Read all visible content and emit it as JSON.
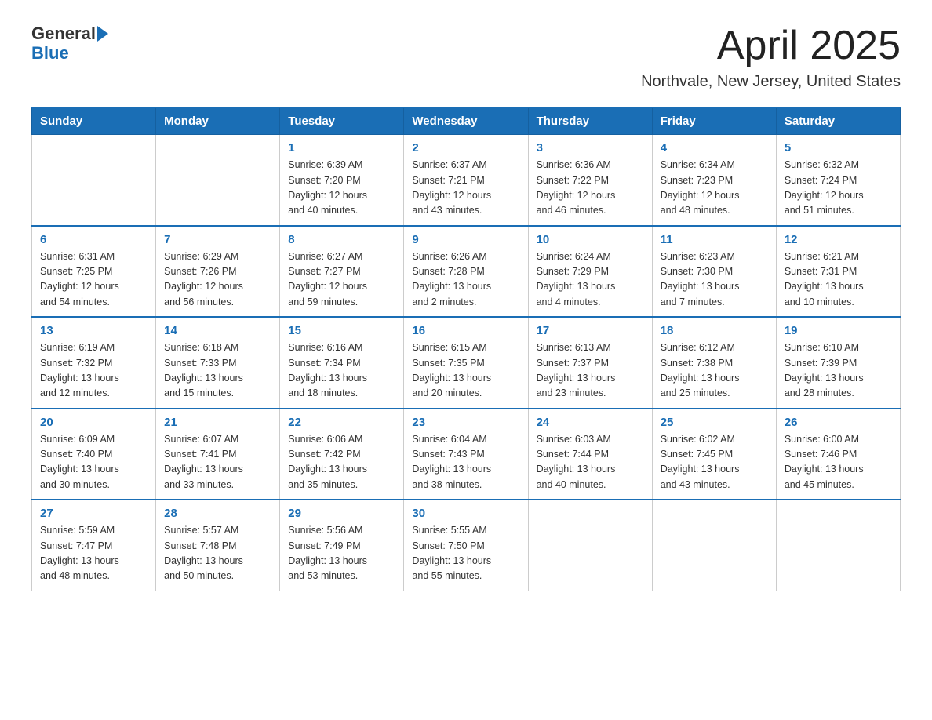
{
  "header": {
    "logo_text_general": "General",
    "logo_text_blue": "Blue",
    "title": "April 2025",
    "subtitle": "Northvale, New Jersey, United States"
  },
  "days_of_week": [
    "Sunday",
    "Monday",
    "Tuesday",
    "Wednesday",
    "Thursday",
    "Friday",
    "Saturday"
  ],
  "weeks": [
    [
      {
        "day": "",
        "info": ""
      },
      {
        "day": "",
        "info": ""
      },
      {
        "day": "1",
        "info": "Sunrise: 6:39 AM\nSunset: 7:20 PM\nDaylight: 12 hours\nand 40 minutes."
      },
      {
        "day": "2",
        "info": "Sunrise: 6:37 AM\nSunset: 7:21 PM\nDaylight: 12 hours\nand 43 minutes."
      },
      {
        "day": "3",
        "info": "Sunrise: 6:36 AM\nSunset: 7:22 PM\nDaylight: 12 hours\nand 46 minutes."
      },
      {
        "day": "4",
        "info": "Sunrise: 6:34 AM\nSunset: 7:23 PM\nDaylight: 12 hours\nand 48 minutes."
      },
      {
        "day": "5",
        "info": "Sunrise: 6:32 AM\nSunset: 7:24 PM\nDaylight: 12 hours\nand 51 minutes."
      }
    ],
    [
      {
        "day": "6",
        "info": "Sunrise: 6:31 AM\nSunset: 7:25 PM\nDaylight: 12 hours\nand 54 minutes."
      },
      {
        "day": "7",
        "info": "Sunrise: 6:29 AM\nSunset: 7:26 PM\nDaylight: 12 hours\nand 56 minutes."
      },
      {
        "day": "8",
        "info": "Sunrise: 6:27 AM\nSunset: 7:27 PM\nDaylight: 12 hours\nand 59 minutes."
      },
      {
        "day": "9",
        "info": "Sunrise: 6:26 AM\nSunset: 7:28 PM\nDaylight: 13 hours\nand 2 minutes."
      },
      {
        "day": "10",
        "info": "Sunrise: 6:24 AM\nSunset: 7:29 PM\nDaylight: 13 hours\nand 4 minutes."
      },
      {
        "day": "11",
        "info": "Sunrise: 6:23 AM\nSunset: 7:30 PM\nDaylight: 13 hours\nand 7 minutes."
      },
      {
        "day": "12",
        "info": "Sunrise: 6:21 AM\nSunset: 7:31 PM\nDaylight: 13 hours\nand 10 minutes."
      }
    ],
    [
      {
        "day": "13",
        "info": "Sunrise: 6:19 AM\nSunset: 7:32 PM\nDaylight: 13 hours\nand 12 minutes."
      },
      {
        "day": "14",
        "info": "Sunrise: 6:18 AM\nSunset: 7:33 PM\nDaylight: 13 hours\nand 15 minutes."
      },
      {
        "day": "15",
        "info": "Sunrise: 6:16 AM\nSunset: 7:34 PM\nDaylight: 13 hours\nand 18 minutes."
      },
      {
        "day": "16",
        "info": "Sunrise: 6:15 AM\nSunset: 7:35 PM\nDaylight: 13 hours\nand 20 minutes."
      },
      {
        "day": "17",
        "info": "Sunrise: 6:13 AM\nSunset: 7:37 PM\nDaylight: 13 hours\nand 23 minutes."
      },
      {
        "day": "18",
        "info": "Sunrise: 6:12 AM\nSunset: 7:38 PM\nDaylight: 13 hours\nand 25 minutes."
      },
      {
        "day": "19",
        "info": "Sunrise: 6:10 AM\nSunset: 7:39 PM\nDaylight: 13 hours\nand 28 minutes."
      }
    ],
    [
      {
        "day": "20",
        "info": "Sunrise: 6:09 AM\nSunset: 7:40 PM\nDaylight: 13 hours\nand 30 minutes."
      },
      {
        "day": "21",
        "info": "Sunrise: 6:07 AM\nSunset: 7:41 PM\nDaylight: 13 hours\nand 33 minutes."
      },
      {
        "day": "22",
        "info": "Sunrise: 6:06 AM\nSunset: 7:42 PM\nDaylight: 13 hours\nand 35 minutes."
      },
      {
        "day": "23",
        "info": "Sunrise: 6:04 AM\nSunset: 7:43 PM\nDaylight: 13 hours\nand 38 minutes."
      },
      {
        "day": "24",
        "info": "Sunrise: 6:03 AM\nSunset: 7:44 PM\nDaylight: 13 hours\nand 40 minutes."
      },
      {
        "day": "25",
        "info": "Sunrise: 6:02 AM\nSunset: 7:45 PM\nDaylight: 13 hours\nand 43 minutes."
      },
      {
        "day": "26",
        "info": "Sunrise: 6:00 AM\nSunset: 7:46 PM\nDaylight: 13 hours\nand 45 minutes."
      }
    ],
    [
      {
        "day": "27",
        "info": "Sunrise: 5:59 AM\nSunset: 7:47 PM\nDaylight: 13 hours\nand 48 minutes."
      },
      {
        "day": "28",
        "info": "Sunrise: 5:57 AM\nSunset: 7:48 PM\nDaylight: 13 hours\nand 50 minutes."
      },
      {
        "day": "29",
        "info": "Sunrise: 5:56 AM\nSunset: 7:49 PM\nDaylight: 13 hours\nand 53 minutes."
      },
      {
        "day": "30",
        "info": "Sunrise: 5:55 AM\nSunset: 7:50 PM\nDaylight: 13 hours\nand 55 minutes."
      },
      {
        "day": "",
        "info": ""
      },
      {
        "day": "",
        "info": ""
      },
      {
        "day": "",
        "info": ""
      }
    ]
  ]
}
